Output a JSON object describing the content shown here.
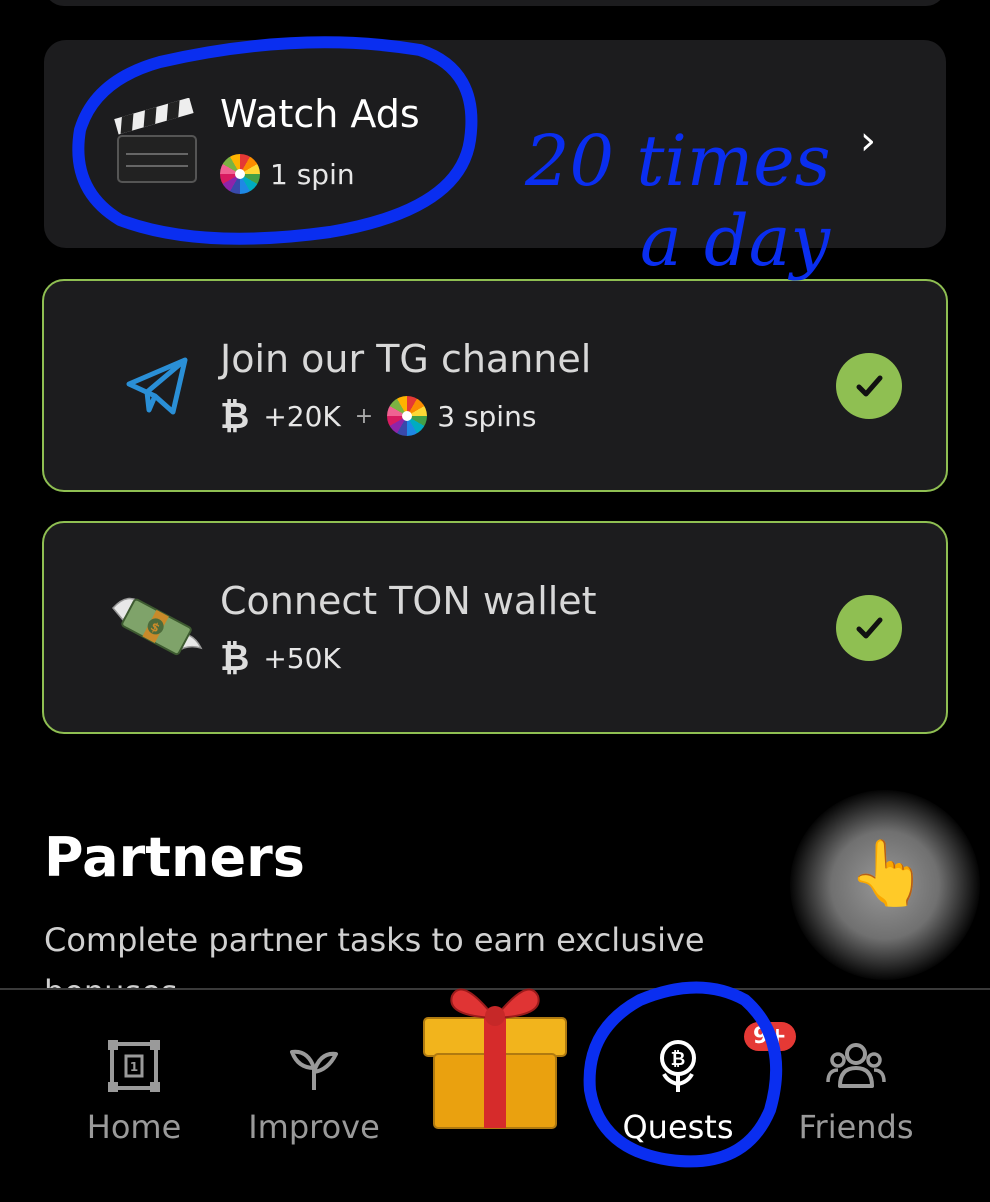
{
  "tasks": [
    {
      "title": "Watch Ads",
      "reward_spins": "1 spin",
      "icon": "clapperboard-icon",
      "status": "open"
    },
    {
      "title": "Join our TG channel",
      "reward_coins": "+20K",
      "plus": "+",
      "reward_spins": "3 spins",
      "icon": "telegram-icon",
      "status": "done"
    },
    {
      "title": "Connect TON wallet",
      "reward_coins": "+50K",
      "icon": "money-with-wings-icon",
      "status": "done"
    }
  ],
  "partners": {
    "title": "Partners",
    "description": "Complete partner tasks to earn exclusive bonuses"
  },
  "nav": {
    "home": "Home",
    "improve": "Improve",
    "quests": "Quests",
    "quests_badge": "9+",
    "friends": "Friends"
  },
  "annotation": {
    "handwritten": "20 times a day",
    "color": "#0a2ef0"
  },
  "colors": {
    "card_bg": "#1c1c1e",
    "done_border": "#8fbf52",
    "badge": "#e53935"
  }
}
